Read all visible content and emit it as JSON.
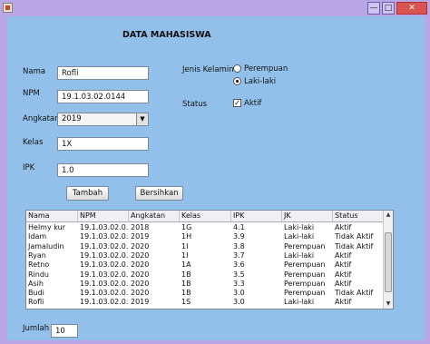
{
  "window": {
    "controls": {
      "minimize": "—",
      "maximize": "□",
      "close": "✕"
    }
  },
  "form": {
    "heading": "DATA MAHASISWA",
    "nama_label": "Nama",
    "nama_value": "Rofli",
    "npm_label": "NPM",
    "npm_value": "19.1.03.02.0144",
    "angkatan_label": "Angkatan",
    "angkatan_value": "2019",
    "kelas_label": "Kelas",
    "kelas_value": "1X",
    "ipk_label": "IPK",
    "ipk_value": "1.0",
    "jenis_kelamin_label": "Jenis Kelamin",
    "gender_options": [
      "Perempuan",
      "Laki-laki"
    ],
    "gender_selected": "Laki-laki",
    "status_label": "Status",
    "aktif_label": "Aktif",
    "aktif_checked": true,
    "tambah_button": "Tambah",
    "bersihkan_button": "Bersihkan",
    "jumlah_label": "Jumlah",
    "jumlah_value": "10"
  },
  "table": {
    "columns": [
      "Nama",
      "NPM",
      "Angkatan",
      "Kelas",
      "IPK",
      "JK",
      "Status"
    ],
    "rows": [
      [
        "Helmy kur",
        "19.1.03.02.0...",
        "2018",
        "1G",
        "4.1",
        "Laki-laki",
        "Aktif"
      ],
      [
        "Idam",
        "19.1.03.02.0...",
        "2019",
        "1H",
        "3.9",
        "Laki-laki",
        "Tidak Aktif"
      ],
      [
        "Jamaludin",
        "19.1.03.02.0...",
        "2020",
        "1I",
        "3.8",
        "Perempuan",
        "Tidak Aktif"
      ],
      [
        "Ryan",
        "19.1.03.02.0...",
        "2020",
        "1I",
        "3.7",
        "Laki-laki",
        "Aktif"
      ],
      [
        "Retno",
        "19.1.03.02.0...",
        "2020",
        "1A",
        "3.6",
        "Perempuan",
        "Aktif"
      ],
      [
        "Rindu",
        "19.1.03.02.0...",
        "2020",
        "1B",
        "3.5",
        "Perempuan",
        "Aktif"
      ],
      [
        "Asih",
        "19.1.03.02.0...",
        "2020",
        "1B",
        "3.3",
        "Perempuan",
        "Aktif"
      ],
      [
        "Budi",
        "19.1.03.02.0...",
        "2020",
        "1B",
        "3.0",
        "Perempuan",
        "Tidak Aktif"
      ],
      [
        "Rofli",
        "19.1.03.02.0...",
        "2019",
        "1S",
        "3.0",
        "Laki-laki",
        "Aktif"
      ]
    ]
  }
}
